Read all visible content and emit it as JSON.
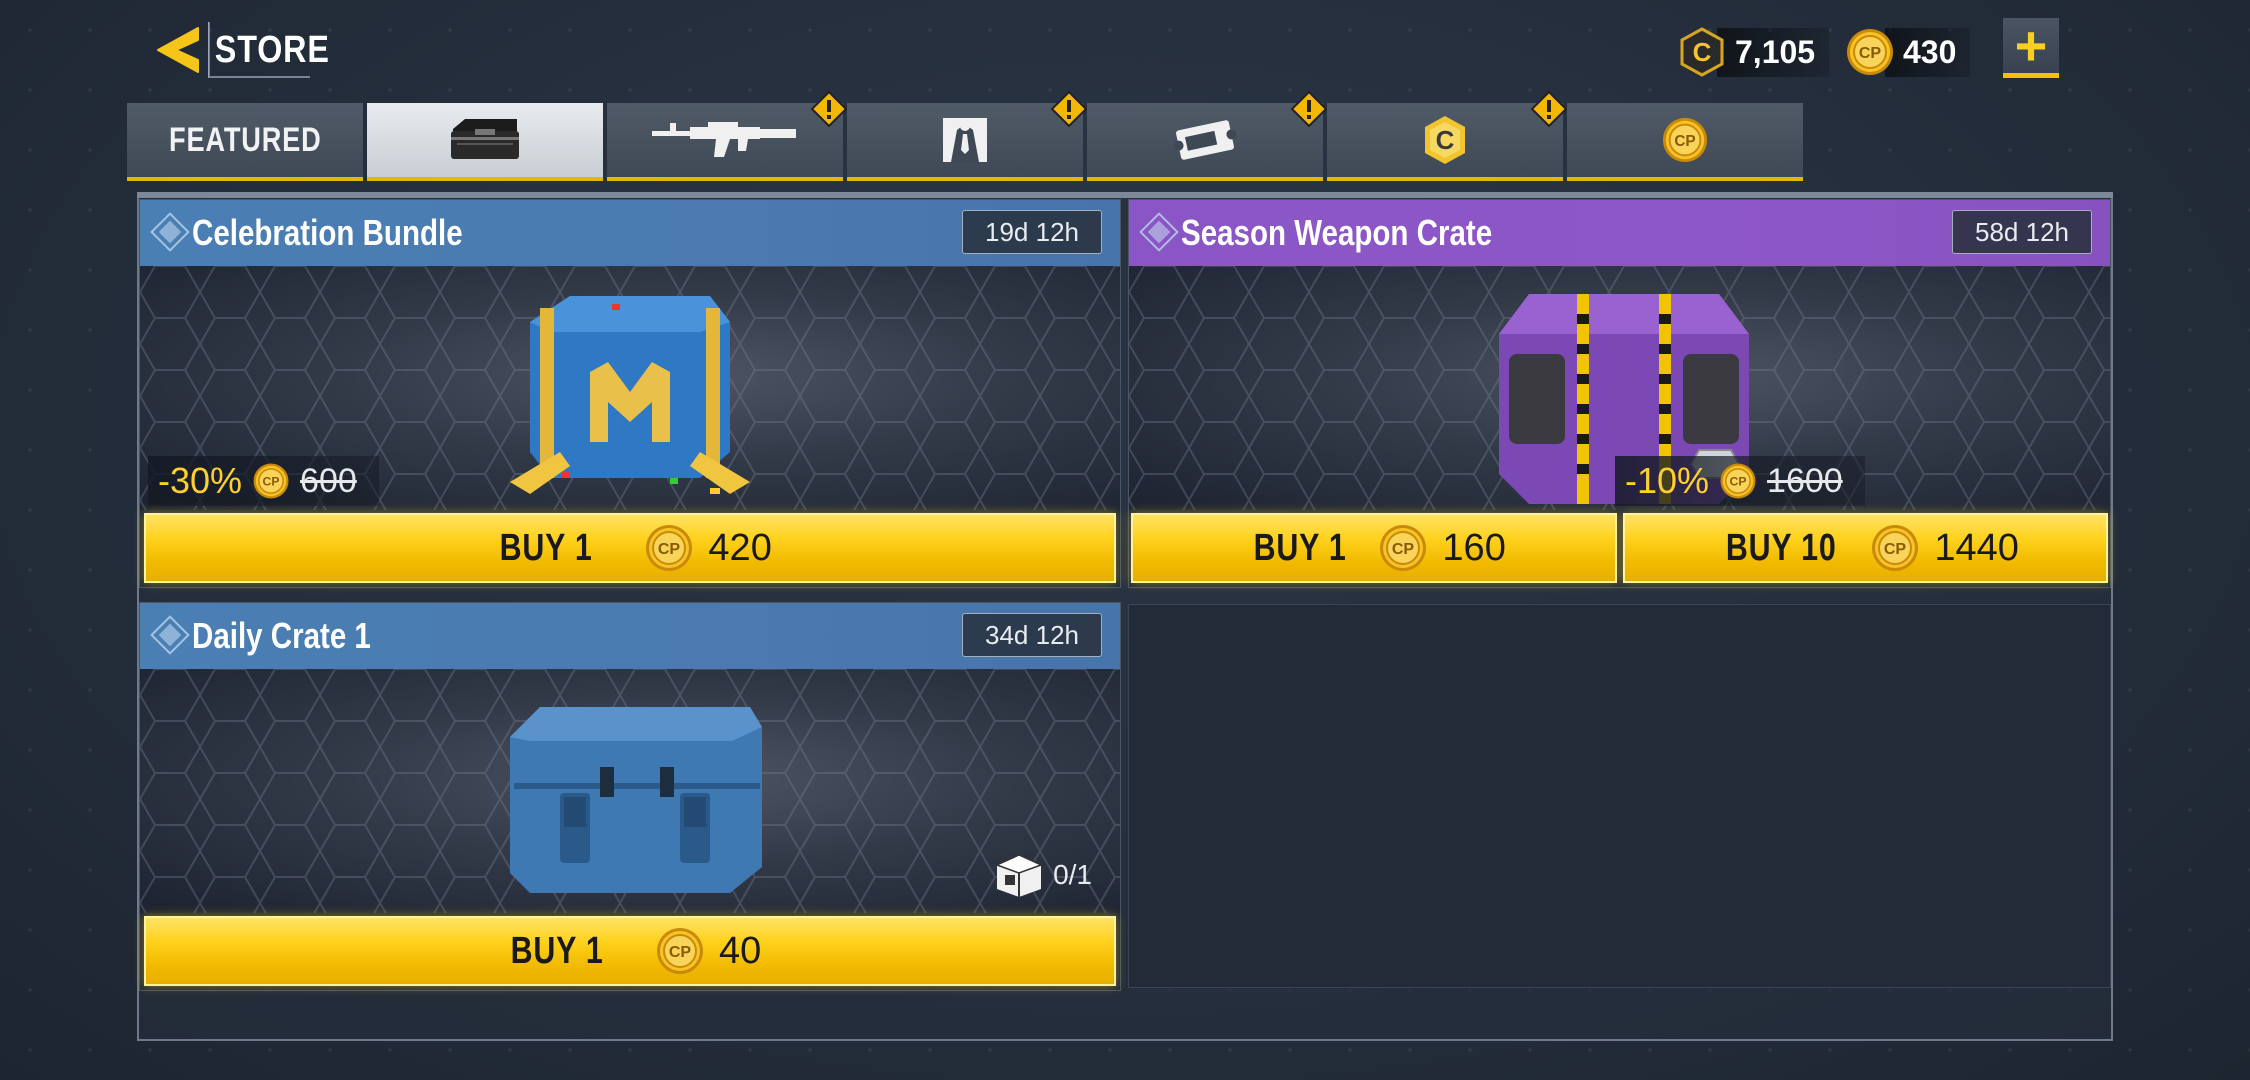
{
  "header": {
    "title": "STORE",
    "cod_points_balance": "7,105",
    "cp_balance": "430",
    "add_label": "+"
  },
  "tabs": [
    {
      "label": "FEATURED",
      "icon": "featured",
      "active": false,
      "alert": false
    },
    {
      "label": "",
      "icon": "crate-icon",
      "active": true,
      "alert": false
    },
    {
      "label": "",
      "icon": "rifle-icon",
      "active": false,
      "alert": true
    },
    {
      "label": "",
      "icon": "character-icon",
      "active": false,
      "alert": true
    },
    {
      "label": "",
      "icon": "ticket-icon",
      "active": false,
      "alert": true
    },
    {
      "label": "",
      "icon": "cod-points-icon",
      "active": false,
      "alert": true
    },
    {
      "label": "",
      "icon": "cp-icon",
      "active": false,
      "alert": false
    }
  ],
  "cards": {
    "celebration": {
      "title": "Celebration Bundle",
      "timer": "19d 12h",
      "discount": "-30%",
      "old_price": "600",
      "buy_label": "BUY 1",
      "price": "420"
    },
    "season": {
      "title": "Season Weapon Crate",
      "timer": "58d 12h",
      "discount": "-10%",
      "old_price": "1600",
      "buy1_label": "BUY 1",
      "buy1_price": "160",
      "buy10_label": "BUY 10",
      "buy10_price": "1440"
    },
    "daily": {
      "title": "Daily Crate 1",
      "timer": "34d 12h",
      "limit": "0/1",
      "buy_label": "BUY 1",
      "price": "40"
    }
  },
  "colors": {
    "accent_gold": "#f2c200",
    "header_blue": "#4a7fb4",
    "header_purple": "#8a55c4",
    "background": "#25303f"
  }
}
